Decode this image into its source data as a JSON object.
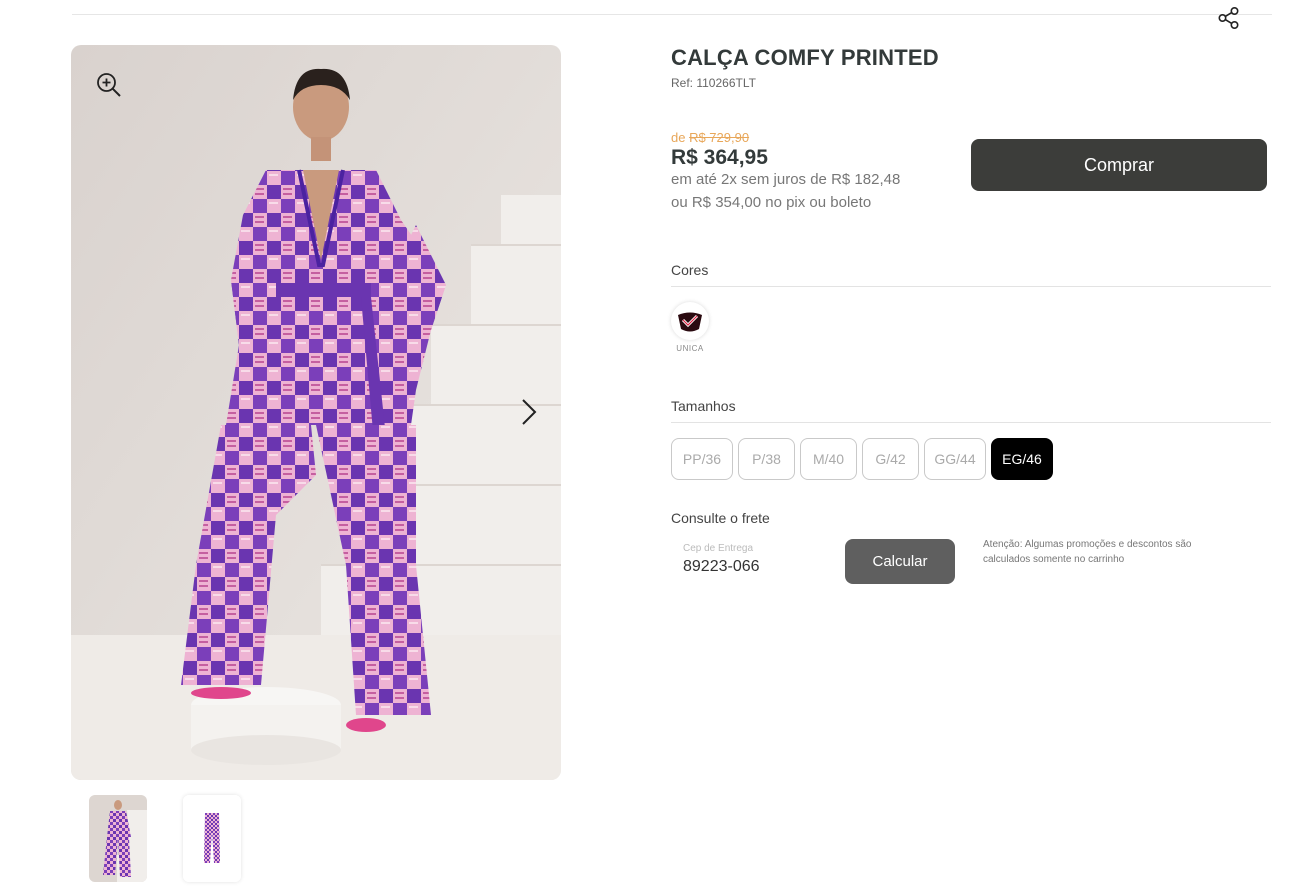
{
  "product": {
    "title": "CALÇA COMFY PRINTED",
    "ref": "Ref: 110266TLT"
  },
  "pricing": {
    "old_prefix": "de ",
    "old_price": "R$ 729,90",
    "price": "R$ 364,95",
    "installments": "em até 2x sem juros de R$ 182,48",
    "pix": "ou R$ 354,00 no pix ou boleto"
  },
  "actions": {
    "buy_label": "Comprar",
    "calculate_label": "Calcular"
  },
  "colors": {
    "label": "Cores",
    "options": [
      {
        "name": "UNICA",
        "selected": true
      }
    ]
  },
  "sizes": {
    "label": "Tamanhos",
    "options": [
      "PP/36",
      "P/38",
      "M/40",
      "G/42",
      "GG/44",
      "EG/46"
    ],
    "selected": "EG/46"
  },
  "shipping": {
    "label": "Consulte o frete",
    "field_label": "Cep de Entrega",
    "value": "89223-066",
    "notice": "Atenção: Algumas promoções e descontos são calculados somente no carrinho"
  },
  "gallery": {
    "thumbnails": 2,
    "active_index": 0
  },
  "theme": {
    "buy_button": "#3c3d3a",
    "selected_size": "#000000",
    "old_price_color": "#e8a75a",
    "print_purple": "#6a35b0",
    "print_pink": "#e79ac5"
  },
  "icons": [
    "share-icon",
    "zoom-in-icon",
    "chevron-right-icon",
    "check-icon"
  ]
}
